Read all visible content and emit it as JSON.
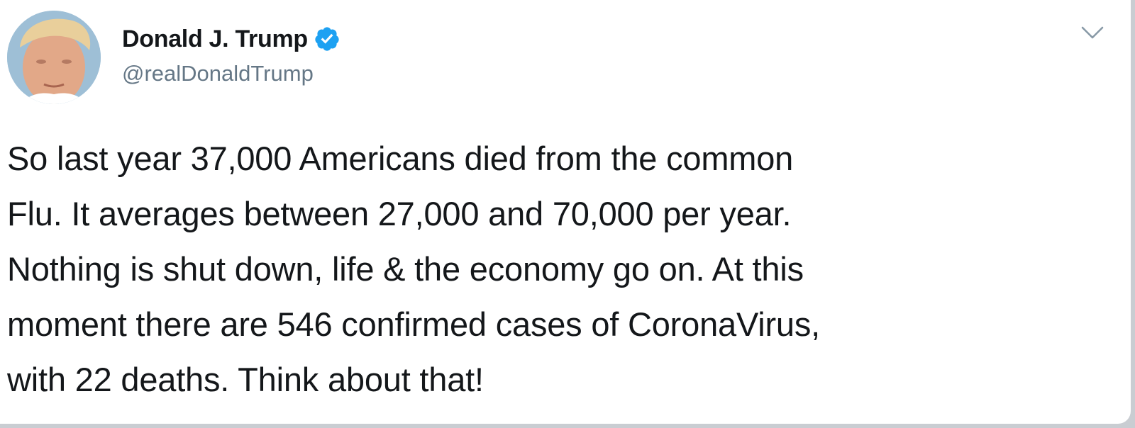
{
  "tweet": {
    "display_name": "Donald J. Trump",
    "handle": "@realDonaldTrump",
    "verified": true,
    "text_lines": [
      "So last year 37,000 Americans died from the common",
      "Flu. It averages between 27,000 and 70,000 per year.",
      "Nothing is shut down, life & the economy go on. At this",
      "moment there are 546 confirmed cases of CoronaVirus,",
      "with 22 deaths. Think about that!"
    ]
  },
  "icons": {
    "verified": "verified-badge-icon",
    "menu": "chevron-down-icon"
  },
  "colors": {
    "text": "#14171a",
    "secondary_text": "#657786",
    "verified_blue": "#1da1f2",
    "card_background": "#ffffff"
  }
}
